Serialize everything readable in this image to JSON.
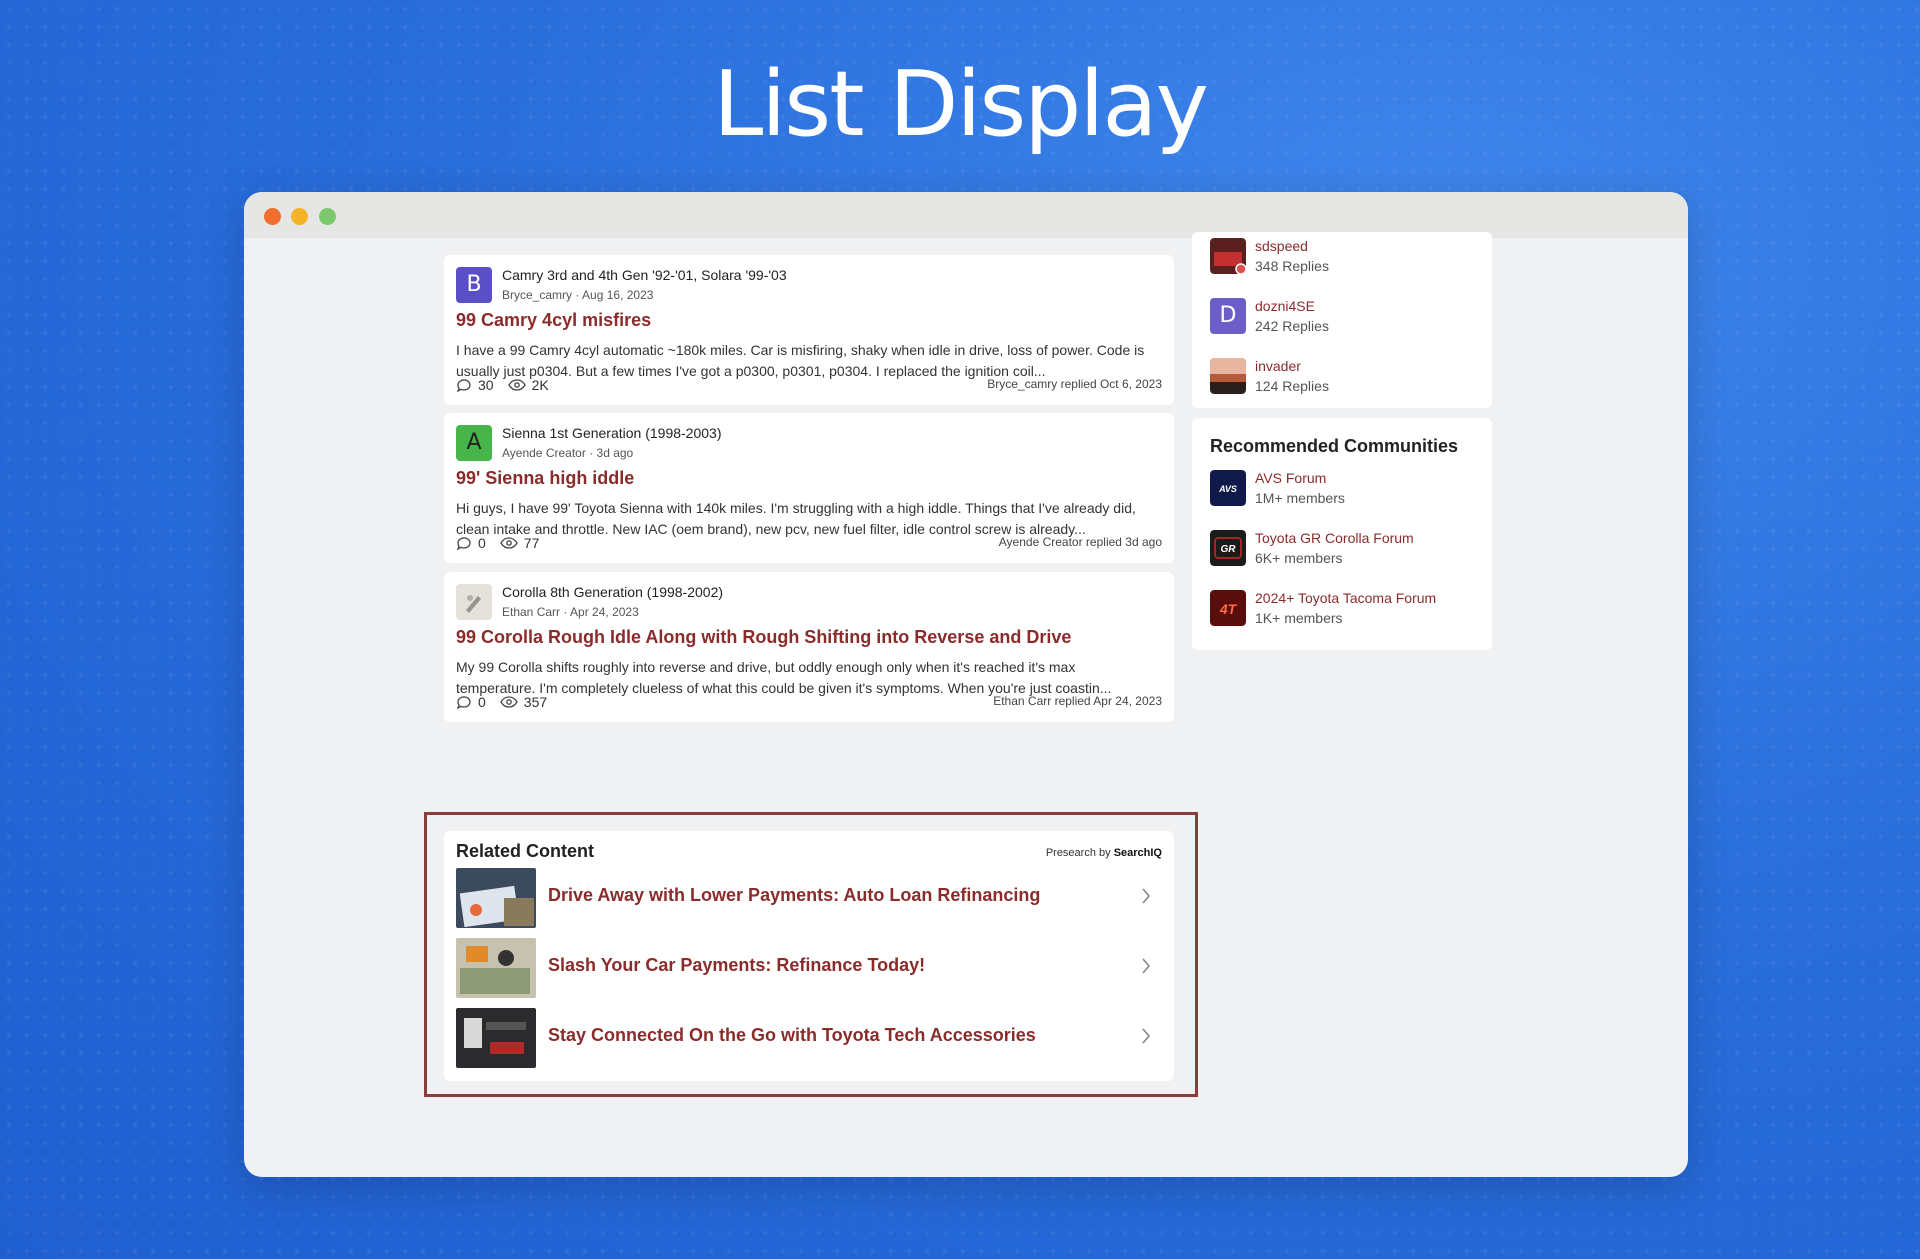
{
  "page": {
    "title": "List Display"
  },
  "threads": [
    {
      "avatar_letter": "B",
      "avatar_color": "#5b4fc8",
      "forum": "Camry 3rd and 4th Gen '92-'01, Solara '99-'03",
      "author": "Bryce_camry",
      "date": "Aug 16, 2023",
      "title": "99 Camry 4cyl misfires",
      "excerpt": "I have a 99 Camry 4cyl automatic ~180k miles. Car is misfiring, shaky when idle in drive, loss of power. Code is usually just p0304. But a few times I've got a p0300, p0301, p0304. I replaced the ignition coil...",
      "replies": "30",
      "views": "2K",
      "replied": "Bryce_camry replied Oct 6, 2023"
    },
    {
      "avatar_letter": "A",
      "avatar_color": "#48b54a",
      "forum": "Sienna 1st Generation (1998-2003)",
      "author": "Ayende Creator",
      "date": "3d ago",
      "title": "99' Sienna high iddle",
      "excerpt": "Hi guys, I have 99' Toyota Sienna with 140k miles. I'm struggling with a high iddle. Things that I've already did, clean intake and throttle. New IAC (oem brand), new pcv, new fuel filter, idle control screw is already...",
      "replies": "0",
      "views": "77",
      "replied": "Ayende Creator replied 3d ago"
    },
    {
      "avatar_letter": "",
      "avatar_color": "#e4e1dc",
      "forum": "Corolla 8th Generation (1998-2002)",
      "author": "Ethan Carr",
      "date": "Apr 24, 2023",
      "title": "99 Corolla Rough Idle Along with Rough Shifting into Reverse and Drive",
      "excerpt": "My 99 Corolla shifts roughly into reverse and drive, but oddly enough only when it's reached it's max temperature. I'm completely clueless of what this could be given it's symptoms. When you're just coastin...",
      "replies": "0",
      "views": "357",
      "replied": "Ethan Carr replied Apr 24, 2023"
    }
  ],
  "related": {
    "heading": "Related Content",
    "powered_prefix": "Presearch by",
    "powered_brand": "SearchIQ",
    "items": [
      {
        "title": "Drive Away with Lower Payments: Auto Loan Refinancing"
      },
      {
        "title": "Slash Your Car Payments: Refinance Today!"
      },
      {
        "title": "Stay Connected On the Go with Toyota Tech Accessories"
      }
    ]
  },
  "top_users": [
    {
      "name": "sdspeed",
      "sub": "348 Replies"
    },
    {
      "name": "dozni4SE",
      "sub": "242 Replies",
      "letter": "D",
      "color": "#6a5fc9"
    },
    {
      "name": "invader",
      "sub": "124 Replies"
    }
  ],
  "recommended": {
    "heading": "Recommended Communities",
    "items": [
      {
        "name": "AVS Forum",
        "sub": "1M+ members",
        "logo_text": "AVS"
      },
      {
        "name": "Toyota GR Corolla Forum",
        "sub": "6K+ members",
        "logo_text": "GR"
      },
      {
        "name": "2024+ Toyota Tacoma Forum",
        "sub": "1K+ members",
        "logo_text": "4T"
      }
    ]
  },
  "colors": {
    "accent": "#8a2c2c",
    "highlight_border": "#8e3b3b",
    "background": "#2a6fdc"
  }
}
